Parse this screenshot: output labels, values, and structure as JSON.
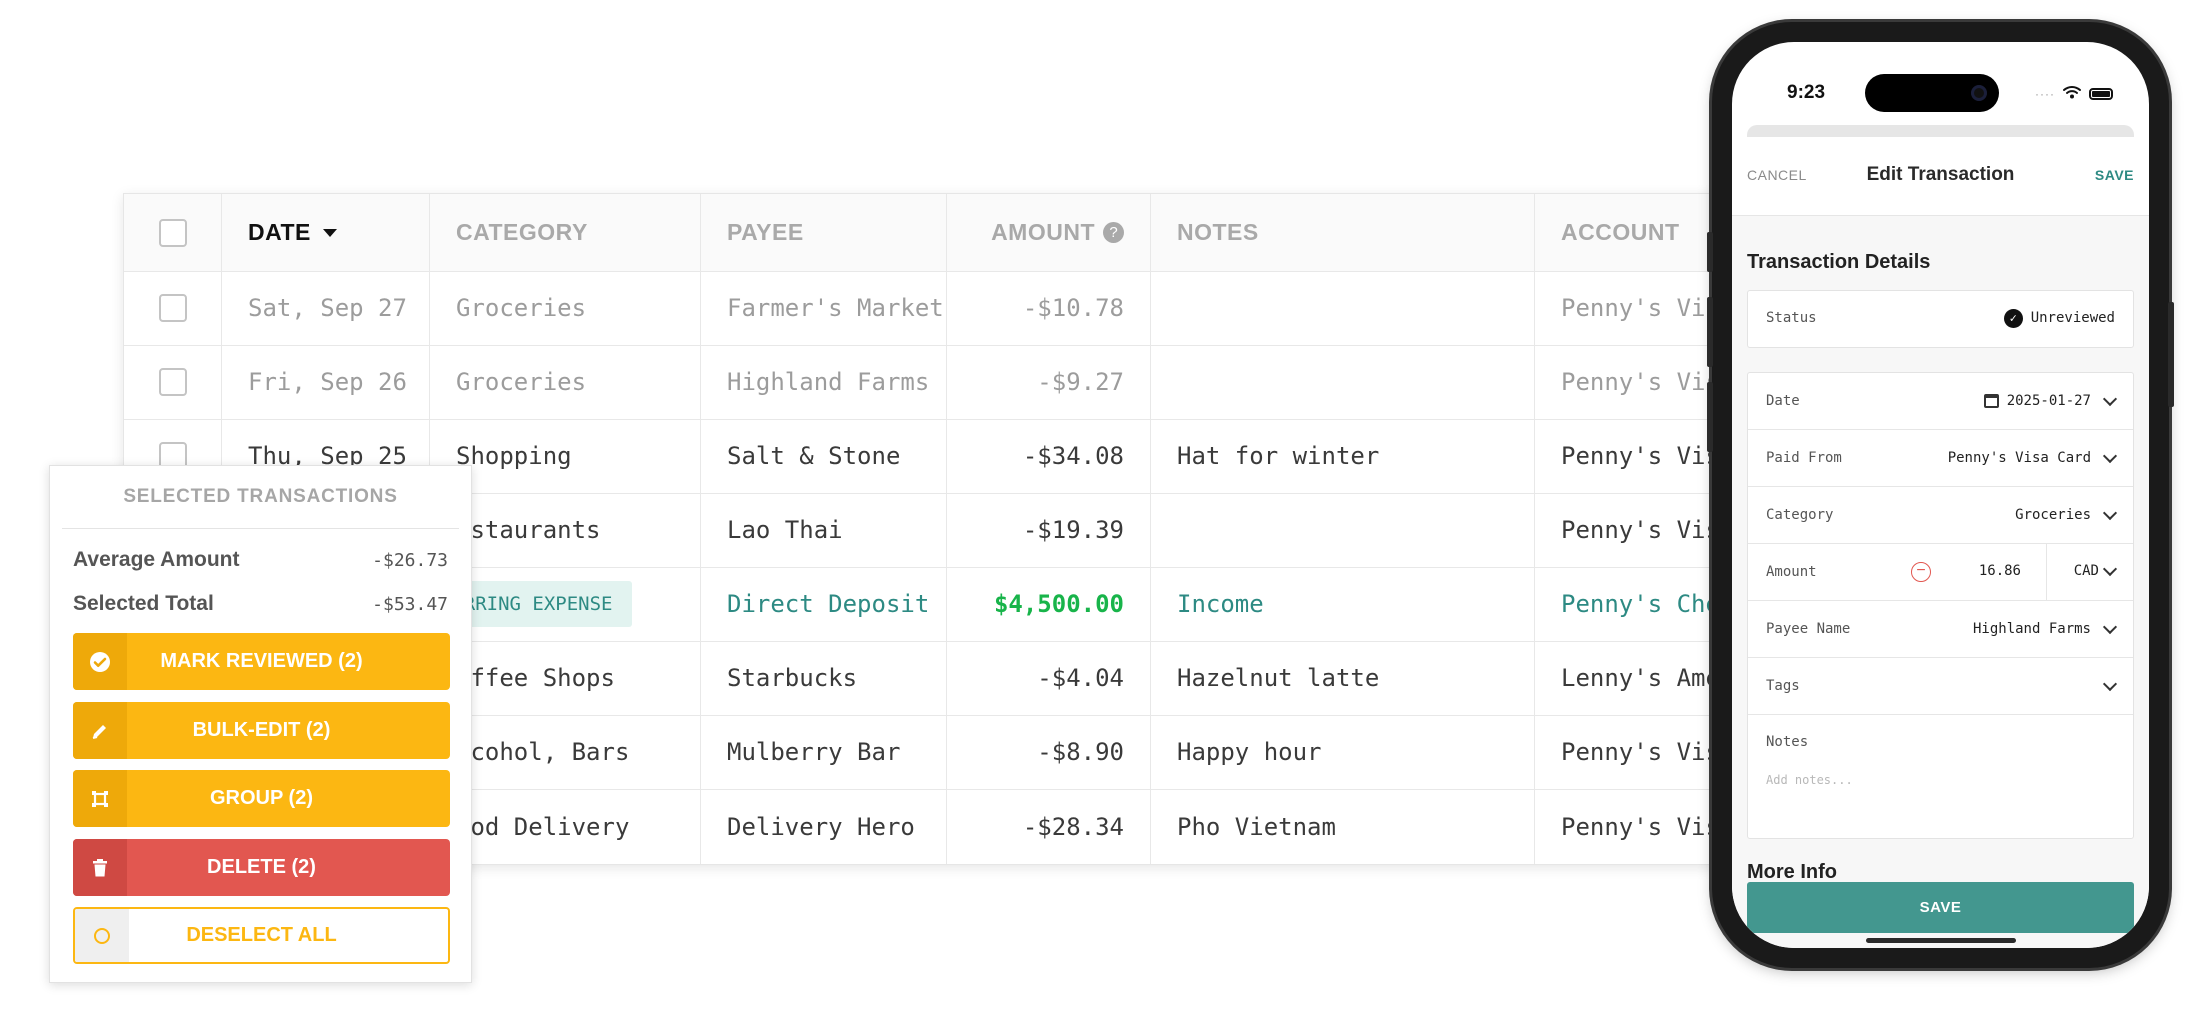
{
  "table": {
    "headers": {
      "date": "DATE",
      "category": "CATEGORY",
      "payee": "PAYEE",
      "amount": "AMOUNT",
      "notes": "NOTES",
      "account": "ACCOUNT"
    },
    "sort_icon": "caret-down-icon",
    "help_icon": "question-circle-icon",
    "rows": [
      {
        "date": "Sat, Sep 27",
        "category": "Groceries",
        "payee": "Farmer's Market",
        "amount": "-$10.78",
        "notes": "",
        "account": "Penny's Visa"
      },
      {
        "date": "Fri, Sep 26",
        "category": "Groceries",
        "payee": "Highland Farms",
        "amount": "-$9.27",
        "notes": "",
        "account": "Penny's Visa"
      },
      {
        "date": "Thu, Sep 25",
        "category": "Shopping",
        "payee": "Salt & Stone",
        "amount": "-$34.08",
        "notes": "Hat for winter",
        "account": "Penny's Visa"
      },
      {
        "date": "",
        "category": "estaurants",
        "payee": "Lao Thai",
        "amount": "-$19.39",
        "notes": "",
        "account": "Penny's Visa"
      },
      {
        "date": "",
        "category": "RECURRING EXPENSE",
        "payee": "Direct Deposit",
        "amount": "$4,500.00",
        "notes": "Income",
        "account": "Penny's Chec"
      },
      {
        "date": "",
        "category": "offee Shops",
        "payee": "Starbucks",
        "amount": "-$4.04",
        "notes": "Hazelnut latte",
        "account": "Lenny's Amex"
      },
      {
        "date": "",
        "category": "lcohol, Bars",
        "payee": "Mulberry Bar",
        "amount": "-$8.90",
        "notes": "Happy hour",
        "account": "Penny's Visa"
      },
      {
        "date": "",
        "category": "ood Delivery",
        "payee": "Delivery Hero",
        "amount": "-$28.34",
        "notes": "Pho Vietnam",
        "account": "Penny's Visa"
      }
    ]
  },
  "selected_panel": {
    "title": "SELECTED TRANSACTIONS",
    "average_label": "Average Amount",
    "average_value": "-$26.73",
    "total_label": "Selected Total",
    "total_value": "-$53.47",
    "buttons": {
      "mark_reviewed": "MARK REVIEWED (2)",
      "bulk_edit": "BULK-EDIT (2)",
      "group": "GROUP (2)",
      "delete": "DELETE (2)",
      "deselect_all": "DESELECT ALL"
    },
    "icons": [
      "check-circle-icon",
      "pencil-icon",
      "group-icon",
      "trash-icon",
      "circle-icon"
    ],
    "colors": {
      "primary": "#fcb712",
      "danger": "#e25750"
    }
  },
  "phone": {
    "status_time": "9:23",
    "nav": {
      "cancel": "CANCEL",
      "title": "Edit Transaction",
      "save": "SAVE"
    },
    "section_details": "Transaction Details",
    "fields": {
      "status_label": "Status",
      "status_value": "Unreviewed",
      "date_label": "Date",
      "date_value": "2025-01-27",
      "paid_from_label": "Paid From",
      "paid_from_value": "Penny's Visa Card",
      "category_label": "Category",
      "category_value": "Groceries",
      "amount_label": "Amount",
      "amount_value": "16.86",
      "currency_value": "CAD",
      "payee_label": "Payee Name",
      "payee_value": "Highland Farms",
      "tags_label": "Tags",
      "notes_label": "Notes",
      "notes_placeholder": "Add notes..."
    },
    "section_more": "More Info",
    "save_button": "SAVE",
    "accent": "#2d8a83"
  }
}
